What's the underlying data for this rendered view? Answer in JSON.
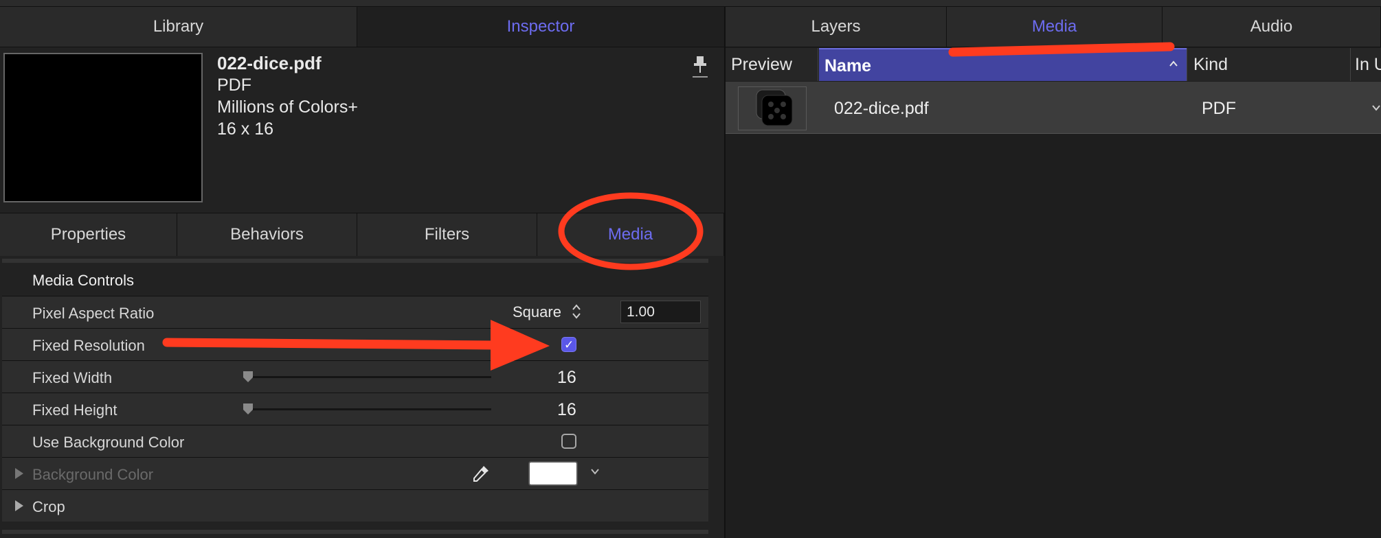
{
  "left_tabs": {
    "library": "Library",
    "inspector": "Inspector"
  },
  "file_info": {
    "name": "022-dice.pdf",
    "type": "PDF",
    "color_depth": "Millions of Colors+",
    "dimensions": "16 x 16"
  },
  "inspector_tabs": {
    "properties": "Properties",
    "behaviors": "Behaviors",
    "filters": "Filters",
    "media": "Media"
  },
  "media_controls": {
    "section_title": "Media Controls",
    "pixel_aspect_ratio": {
      "label": "Pixel Aspect Ratio",
      "selected": "Square",
      "value": "1.00"
    },
    "fixed_resolution": {
      "label": "Fixed Resolution",
      "checked": true
    },
    "fixed_width": {
      "label": "Fixed Width",
      "value": "16"
    },
    "fixed_height": {
      "label": "Fixed Height",
      "value": "16"
    },
    "use_background_color": {
      "label": "Use Background Color",
      "checked": false
    },
    "background_color": {
      "label": "Background Color",
      "swatch": "#ffffff"
    },
    "crop": {
      "label": "Crop"
    }
  },
  "right_tabs": {
    "layers": "Layers",
    "media": "Media",
    "audio": "Audio"
  },
  "media_list": {
    "columns": {
      "preview": "Preview",
      "name": "Name",
      "kind": "Kind",
      "in_use": "In U"
    },
    "rows": [
      {
        "name": "022-dice.pdf",
        "kind": "PDF"
      }
    ]
  },
  "colors": {
    "accent": "#6d6cf0",
    "annotation": "#ff3b1f",
    "header_selected": "#4244a0"
  }
}
